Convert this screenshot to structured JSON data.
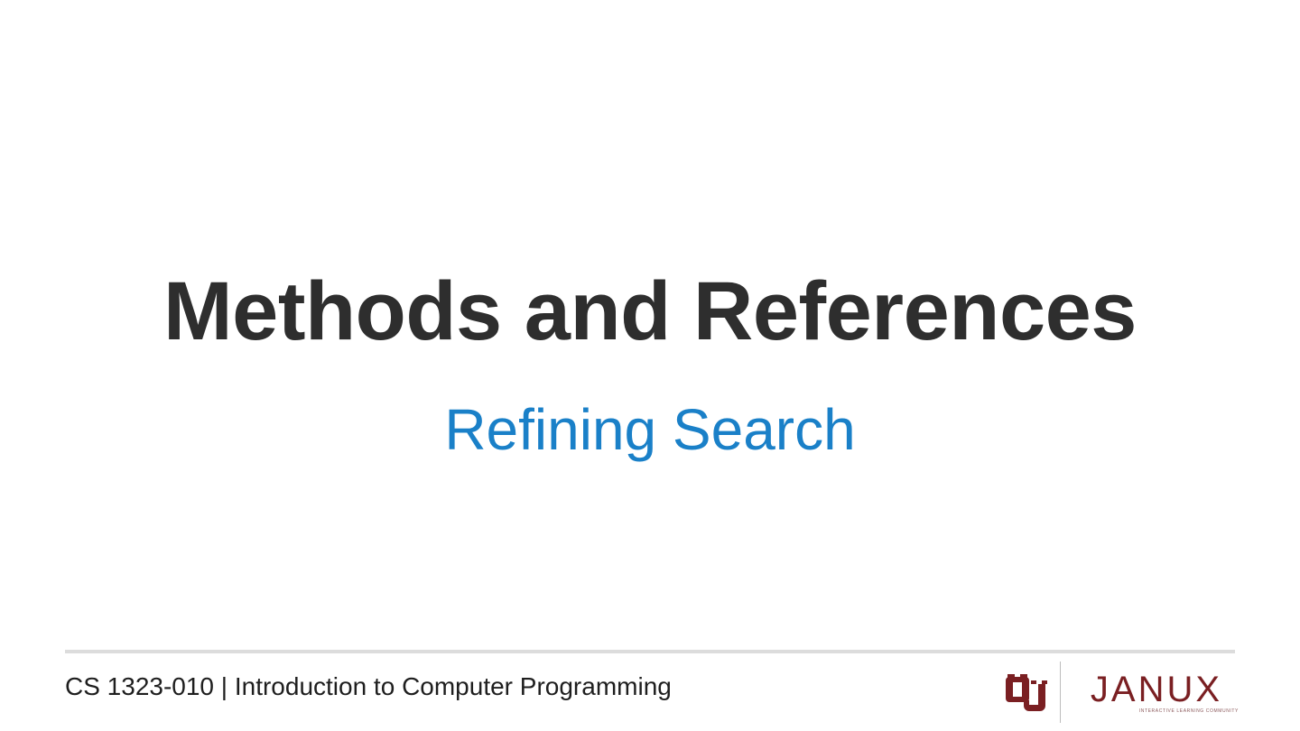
{
  "slide": {
    "title": "Methods and References",
    "subtitle": "Refining Search"
  },
  "footer": {
    "course": "CS 1323-010 | Introduction to Computer Programming"
  },
  "branding": {
    "ou_logo_icon": "ou-interlocking-logo-icon",
    "janux_wordmark": "JANUX",
    "janux_tagline": "INTERACTIVE LEARNING COMMUNITY"
  },
  "colors": {
    "title": "#2e2e2e",
    "subtitle": "#1a80c8",
    "divider": "#dcdcdc",
    "brand_crimson": "#7a1f22"
  }
}
